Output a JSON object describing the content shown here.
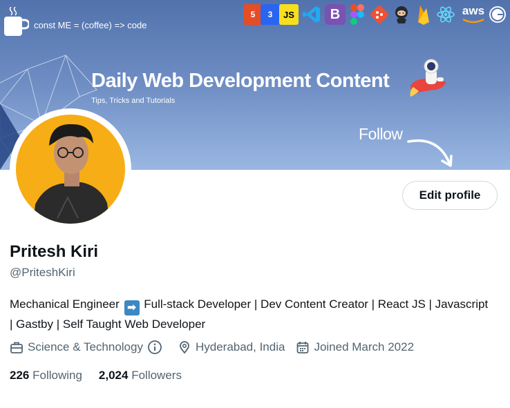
{
  "banner": {
    "tagline": "const ME = (coffee) => code",
    "title": "Daily Web Development Content",
    "subtitle": "Tips, Tricks and Tutorials",
    "follow_text": "Follow",
    "tech_icons": [
      "html5",
      "css3",
      "js",
      "vscode",
      "bootstrap",
      "figma",
      "git",
      "github",
      "firebase",
      "react",
      "aws",
      "gatsby"
    ],
    "aws_label": "aws"
  },
  "profile": {
    "edit_button": "Edit profile",
    "name": "Pritesh Kiri",
    "handle": "@PriteshKiri",
    "bio_part1": "Mechanical Engineer",
    "bio_part2": "Full-stack Developer | Dev Content Creator | React JS | Javascript | Gastby | Self Taught Web Developer",
    "category": "Science & Technology",
    "location": "Hyderabad, India",
    "joined": "Joined March 2022",
    "following_count": "226",
    "following_label": "Following",
    "followers_count": "2,024",
    "followers_label": "Followers"
  },
  "colors": {
    "accent": "#1d9bf0",
    "secondary_text": "#536471",
    "avatar_bg": "#f7ad15"
  }
}
